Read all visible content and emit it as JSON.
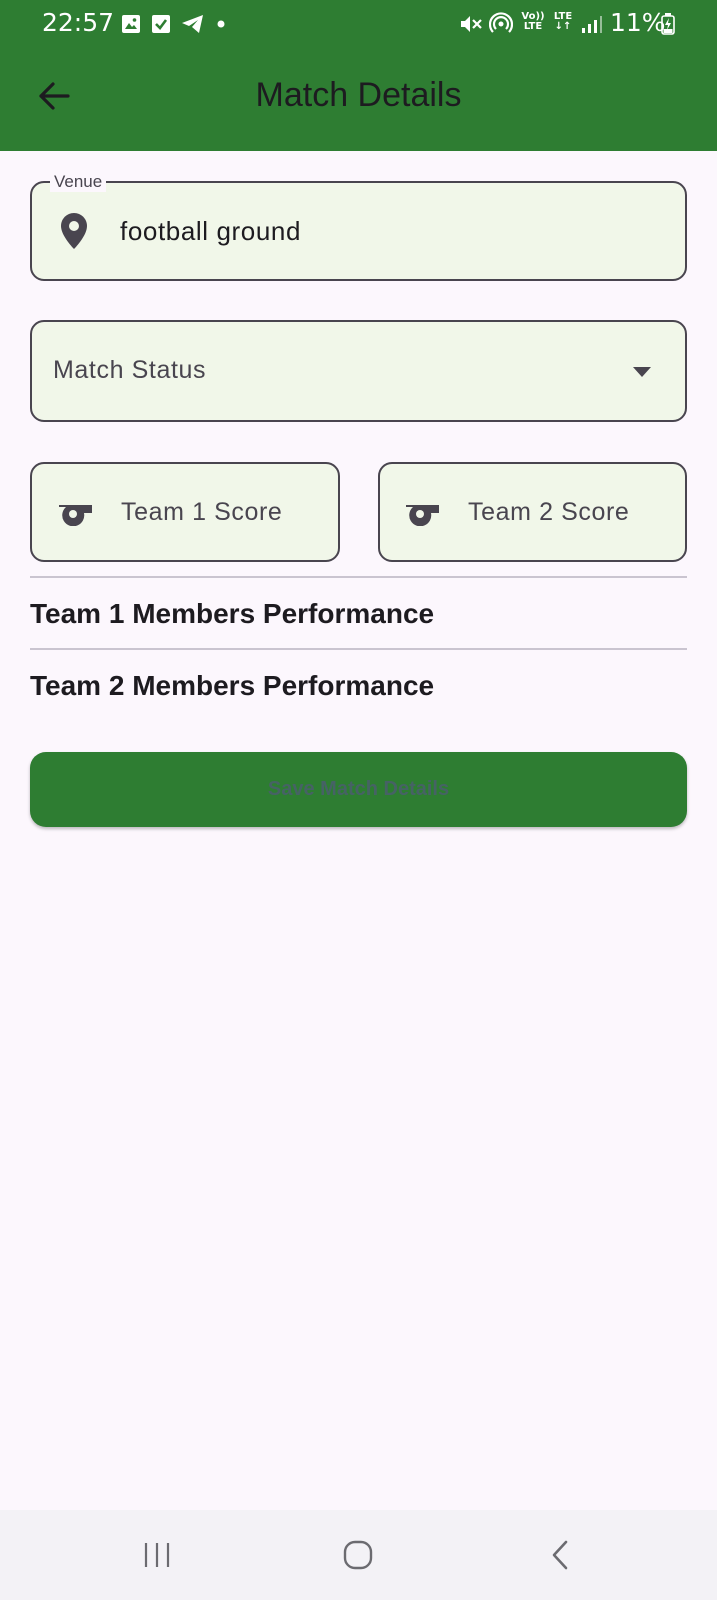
{
  "status_bar": {
    "time": "22:57",
    "battery": "11%",
    "network_top": "LTE",
    "volte_top": "Vo))",
    "volte_bottom": "LTE"
  },
  "app_bar": {
    "title": "Match Details",
    "back_icon": "arrow-back-icon"
  },
  "form": {
    "venue": {
      "label": "Venue",
      "value": "football ground",
      "icon": "location-pin-icon"
    },
    "match_status": {
      "placeholder": "Match Status",
      "icon": "dropdown-arrow-icon"
    },
    "team1_score": {
      "placeholder": "Team 1 Score",
      "icon": "whistle-icon"
    },
    "team2_score": {
      "placeholder": "Team 2 Score",
      "icon": "whistle-icon"
    }
  },
  "sections": {
    "team1_performance": "Team 1 Members Performance",
    "team2_performance": "Team 2 Members Performance"
  },
  "save_button": {
    "label": "Save Match Details"
  },
  "colors": {
    "primary": "#2e7d32",
    "background": "#fcf7fd",
    "field_fill": "#f1f7e9",
    "outline": "#49454f"
  }
}
